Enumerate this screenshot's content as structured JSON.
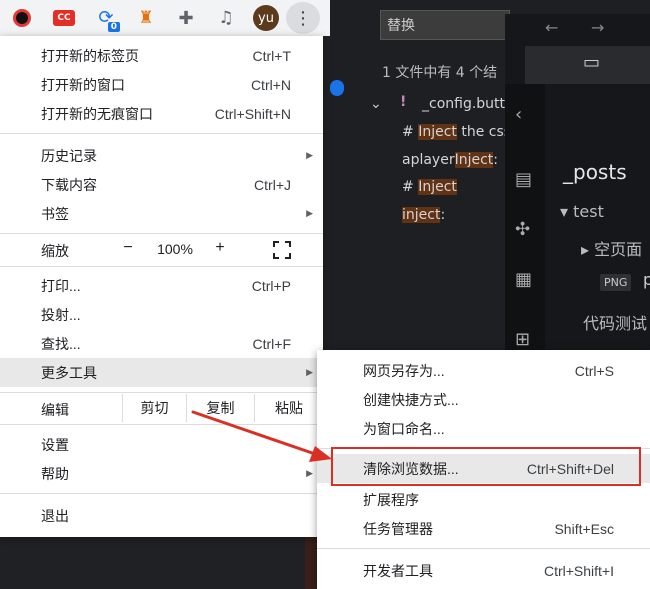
{
  "toolbar": {
    "extensions": [
      {
        "icon": "ext-record-icon"
      },
      {
        "icon": "ext-cc-icon",
        "text": "CC"
      },
      {
        "icon": "ext-sync-icon",
        "badge": "0"
      },
      {
        "icon": "ext-tower-icon"
      },
      {
        "icon": "extensions-puzzle-icon"
      },
      {
        "icon": "media-controls-icon"
      }
    ],
    "avatar": "yu",
    "menu_icon": "more-vertical-icon"
  },
  "editor": {
    "search_placeholder": "替换",
    "result_summary": "1 文件中有 4 个结",
    "file_name": "_config.butt",
    "lines": [
      {
        "prefix": "# ",
        "hl": "Inject",
        "suffix": " the css"
      },
      {
        "prefix": "aplayer",
        "hl": "Inject",
        "suffix": ":"
      },
      {
        "prefix": "# ",
        "hl": "Inject",
        "suffix": ""
      },
      {
        "prefix": "",
        "hl": "inject",
        "suffix": ":"
      }
    ],
    "panel": {
      "title": "_posts",
      "folder": "test",
      "subfolder": "空页面",
      "png_tag": "PNG",
      "png_rest": "p",
      "next_item": "代码测试"
    }
  },
  "menu": {
    "new_tab": {
      "label": "打开新的标签页",
      "shortcut": "Ctrl+T"
    },
    "new_window": {
      "label": "打开新的窗口",
      "shortcut": "Ctrl+N"
    },
    "new_incognito": {
      "label": "打开新的无痕窗口",
      "shortcut": "Ctrl+Shift+N"
    },
    "history": {
      "label": "历史记录"
    },
    "downloads": {
      "label": "下载内容",
      "shortcut": "Ctrl+J"
    },
    "bookmarks": {
      "label": "书签"
    },
    "zoom": {
      "label": "缩放",
      "minus": "−",
      "value": "100%",
      "plus": "+"
    },
    "print": {
      "label": "打印...",
      "shortcut": "Ctrl+P"
    },
    "cast": {
      "label": "投射..."
    },
    "find": {
      "label": "查找...",
      "shortcut": "Ctrl+F"
    },
    "more_tools": {
      "label": "更多工具"
    },
    "edit": {
      "label": "编辑",
      "cut": "剪切",
      "copy": "复制",
      "paste": "粘贴"
    },
    "settings": {
      "label": "设置"
    },
    "help": {
      "label": "帮助"
    },
    "exit": {
      "label": "退出"
    }
  },
  "submenu": {
    "save_page": {
      "label": "网页另存为...",
      "shortcut": "Ctrl+S"
    },
    "create_shortcut": {
      "label": "创建快捷方式..."
    },
    "name_window": {
      "label": "为窗口命名..."
    },
    "clear_data": {
      "label": "清除浏览数据...",
      "shortcut": "Ctrl+Shift+Del"
    },
    "extensions": {
      "label": "扩展程序"
    },
    "task_manager": {
      "label": "任务管理器",
      "shortcut": "Shift+Esc"
    },
    "dev_tools": {
      "label": "开发者工具",
      "shortcut": "Ctrl+Shift+I"
    }
  },
  "colors": {
    "annotation_red": "#d93025",
    "hover_gray": "#e8e8e8"
  }
}
